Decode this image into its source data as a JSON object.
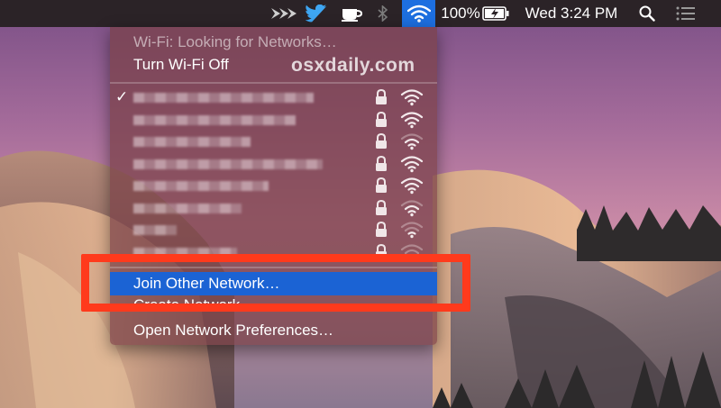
{
  "menubar": {
    "battery_percent": "100%",
    "clock": "Wed 3:24 PM",
    "icons": [
      "arrows-icon",
      "twitter-icon",
      "coffee-cup-icon",
      "bluetooth-icon",
      "wifi-icon",
      "battery-charging-icon",
      "spotlight-search-icon",
      "notification-center-icon"
    ]
  },
  "wifi_menu": {
    "status": "Wi-Fi: Looking for Networks…",
    "toggle": "Turn Wi-Fi Off",
    "watermark": "osxdaily.com",
    "networks": [
      {
        "connected": true,
        "locked": true,
        "signal": 3
      },
      {
        "connected": false,
        "locked": true,
        "signal": 3
      },
      {
        "connected": false,
        "locked": true,
        "signal": 2
      },
      {
        "connected": false,
        "locked": true,
        "signal": 3
      },
      {
        "connected": false,
        "locked": true,
        "signal": 3
      },
      {
        "connected": false,
        "locked": true,
        "signal": 2
      },
      {
        "connected": false,
        "locked": true,
        "signal": 1
      },
      {
        "connected": false,
        "locked": true,
        "signal": 1
      }
    ],
    "join_other": "Join Other Network…",
    "create_network": "Create Network…",
    "open_prefs": "Open Network Preferences…"
  },
  "colors": {
    "menubar_bg": "#2b2327",
    "wifi_active_bg": "#1d6fe0",
    "selection": "#1b63d4",
    "highlight_box": "#ff3a1c"
  }
}
